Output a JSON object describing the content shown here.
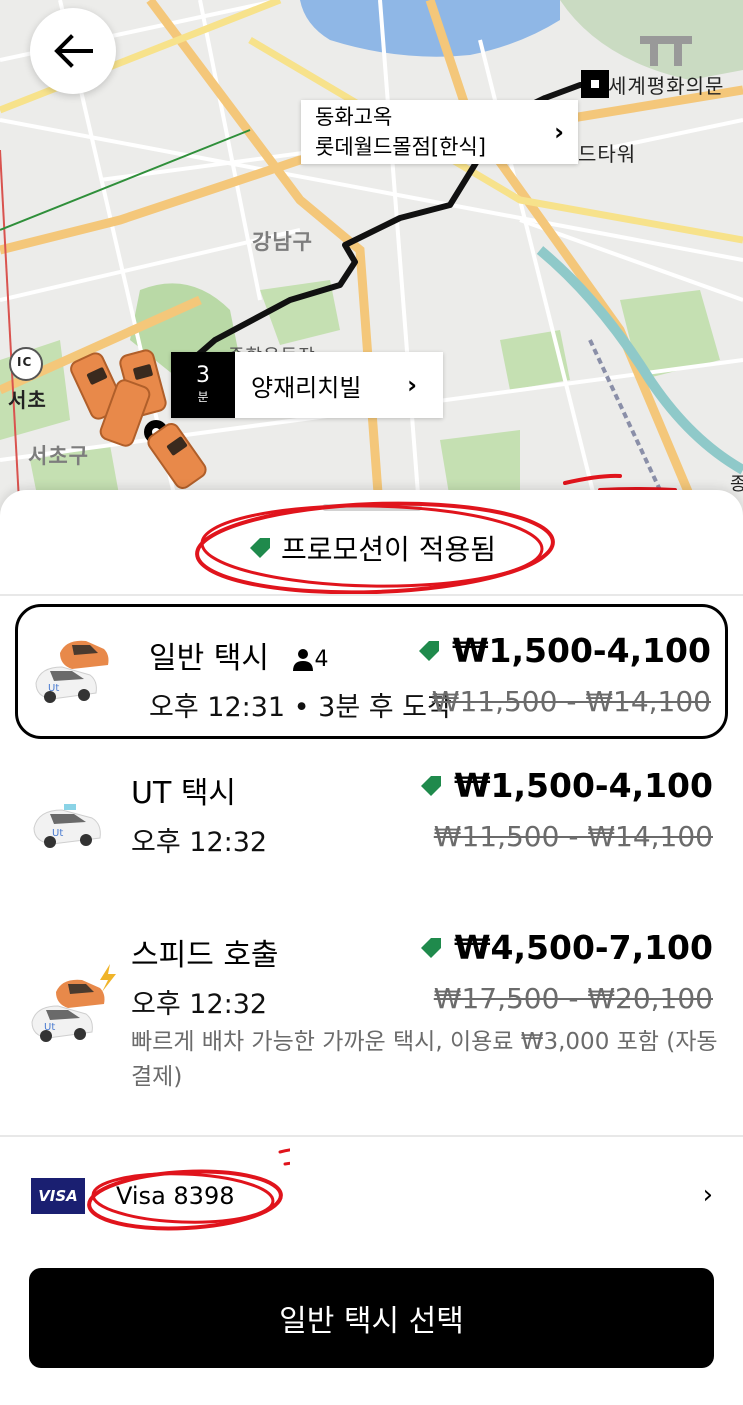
{
  "map": {
    "labels": {
      "gangnam": "강남구",
      "seocho": "서초",
      "seochogu": "서초구",
      "ic": "IC",
      "landmark": "세계평화의문",
      "tower": "드타워",
      "station": "종합운동장",
      "edge": "종"
    },
    "destination_card": {
      "line1": "동화고옥",
      "line2": "롯데월드몰점[한식]",
      "chevron": "›"
    },
    "origin_card": {
      "eta_value": "3",
      "eta_unit": "분",
      "name": "양재리치빌",
      "chevron": "›"
    },
    "route_color": "#111111",
    "taxi_color": "#e8894a"
  },
  "sheet": {
    "promo_label": "프로모션이 적용됨",
    "promo_icon": "tag-icon",
    "annotation_color": "#e0141c",
    "rides": [
      {
        "name": "일반 택시",
        "seats": "4",
        "time": "오후 12:31 • 3분 후 도착",
        "price": "₩1,500-4,100",
        "original_price": "₩11,500 - ₩14,100",
        "selected": true
      },
      {
        "name": "UT  택시",
        "time": "오후 12:32",
        "price": "₩1,500-4,100",
        "original_price": "₩11,500 - ₩14,100",
        "selected": false
      },
      {
        "name": "스피드 호출",
        "time": "오후 12:32",
        "price": "₩4,500-7,100",
        "original_price": "₩17,500 - ₩20,100",
        "description": "빠르게 배차 가능한 가까운 택시, 이용료 ₩3,000 포함 (자동 결제)",
        "selected": false
      }
    ],
    "payment": {
      "brand": "VISA",
      "label": "Visa 8398",
      "chevron": "›"
    },
    "cta_label": "일반 택시 선택"
  }
}
